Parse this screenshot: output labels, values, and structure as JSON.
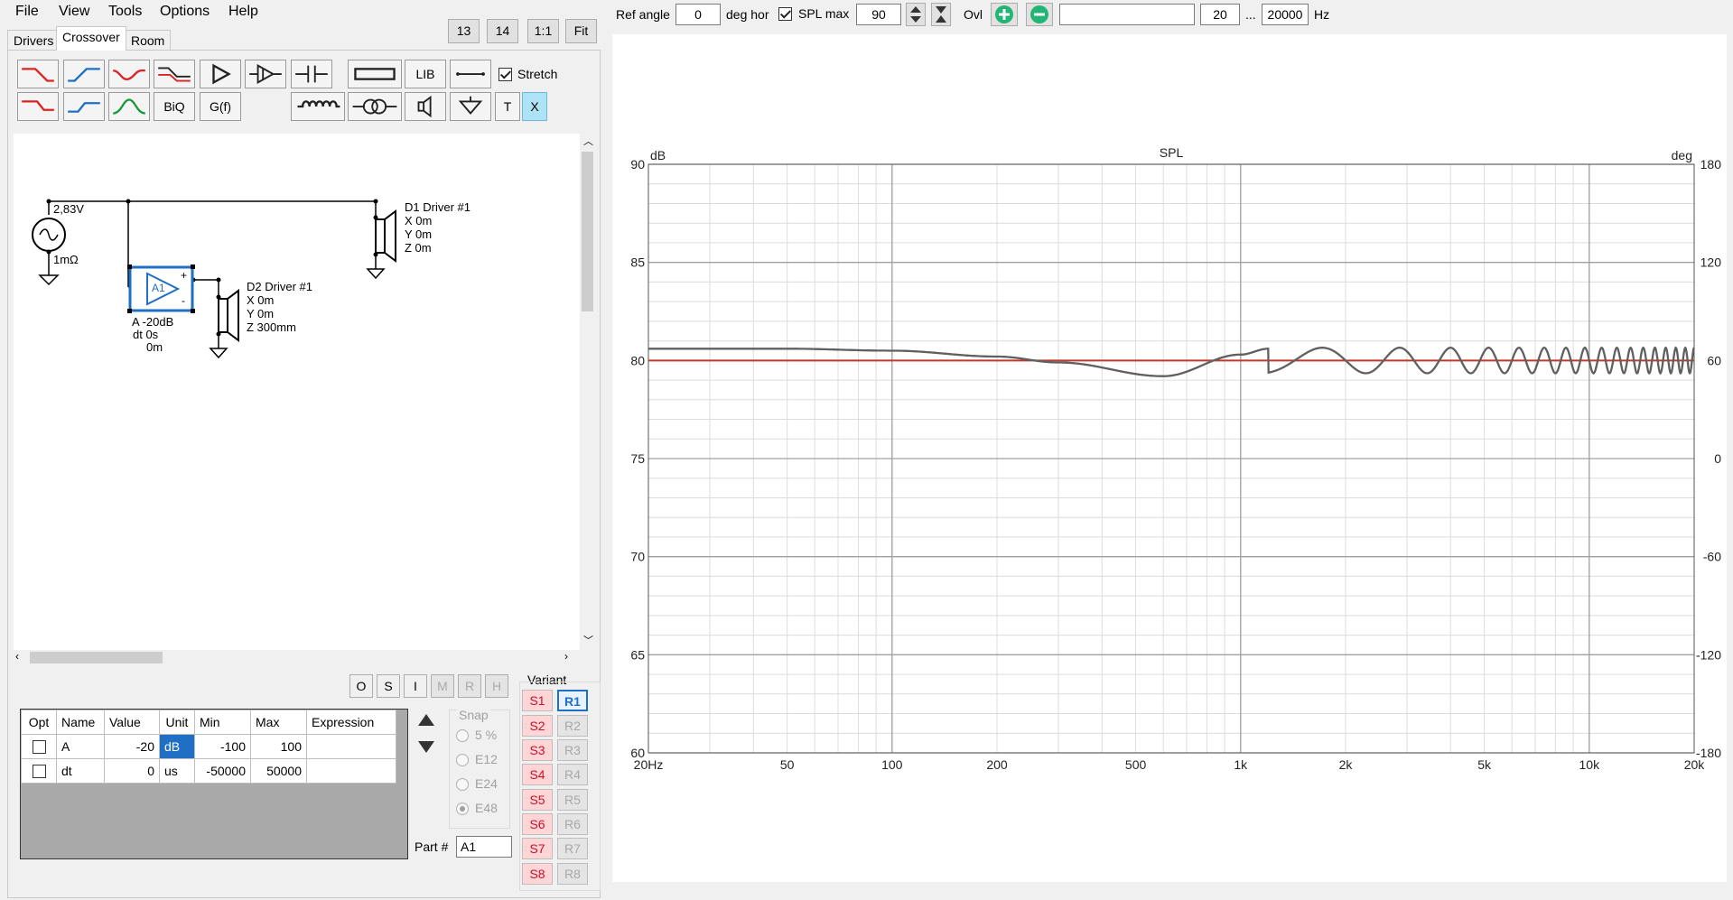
{
  "menu": [
    "File",
    "View",
    "Tools",
    "Options",
    "Help"
  ],
  "tabs": [
    "Drivers",
    "Crossover",
    "Room"
  ],
  "zoom_buttons": [
    "13",
    "14",
    "1:1",
    "Fit"
  ],
  "toolbar": {
    "lib_label": "LIB",
    "biq_label": "BiQ",
    "gf_label": "G(f)",
    "t_label": "T",
    "x_label": "X",
    "stretch_label": "Stretch",
    "stretch_checked": true
  },
  "top_bar": {
    "ref_angle_label": "Ref angle",
    "ref_angle_value": "0",
    "deg_hor_label": "deg hor",
    "spl_max_label": "SPL max",
    "spl_max_checked": true,
    "spl_max_value": "90",
    "ovl_label": "Ovl",
    "ovl_text": "",
    "freq_min": "20",
    "ellipsis": "...",
    "freq_max": "20000",
    "hz_label": "Hz"
  },
  "schematic": {
    "source_voltage": "2,83V",
    "source_impedance": "1mΩ",
    "amp_name": "A1",
    "amp_plus": "+",
    "amp_minus": "-",
    "amp_params": [
      "A -20dB",
      "dt 0s",
      "0m"
    ],
    "d1": {
      "name": "D1 Driver #1",
      "x": "X 0m",
      "y": "Y 0m",
      "z": "Z 0m"
    },
    "d2": {
      "name": "D2 Driver #1",
      "x": "X 0m",
      "y": "Y 0m",
      "z": "Z 300mm"
    }
  },
  "mode_buttons": [
    "O",
    "S",
    "I",
    "M",
    "R",
    "H"
  ],
  "param_table": {
    "headers": [
      "Opt",
      "Name",
      "Value",
      "Unit",
      "Min",
      "Max",
      "Expression"
    ],
    "rows": [
      {
        "name": "A",
        "value": "-20",
        "unit": "dB",
        "min": "-100",
        "max": "100",
        "expression": ""
      },
      {
        "name": "dt",
        "value": "0",
        "unit": "us",
        "min": "-50000",
        "max": "50000",
        "expression": ""
      }
    ]
  },
  "snap": {
    "label": "Snap",
    "options": [
      "5 %",
      "E12",
      "E24",
      "E48"
    ],
    "selected": "E48"
  },
  "part": {
    "label": "Part #",
    "value": "A1"
  },
  "variant": {
    "label": "Variant",
    "s_buttons": [
      "S1",
      "S2",
      "S3",
      "S4",
      "S5",
      "S6",
      "S7",
      "S8"
    ],
    "r_buttons": [
      "R1",
      "R2",
      "R3",
      "R4",
      "R5",
      "R6",
      "R7",
      "R8"
    ],
    "selected": "R1"
  },
  "colors": {
    "accent_blue": "#1f6fc5",
    "spl_curve": "#606060",
    "phase_curve": "#c0392b",
    "grid_major": "#a0a0a0",
    "grid_minor": "#dcdcdc"
  },
  "chart_data": {
    "type": "line",
    "title": "SPL",
    "left_unit": "dB",
    "right_unit": "deg",
    "x_scale": "log",
    "xlim": [
      20,
      20000
    ],
    "x_ticks": [
      "20Hz",
      "50",
      "100",
      "200",
      "500",
      "1k",
      "2k",
      "5k",
      "10k",
      "20k"
    ],
    "x_tick_values": [
      20,
      50,
      100,
      200,
      500,
      1000,
      2000,
      5000,
      10000,
      20000
    ],
    "ylim": [
      60,
      90
    ],
    "y_ticks": [
      "90",
      "85",
      "80",
      "75",
      "70",
      "65",
      "60"
    ],
    "y2lim": [
      -180,
      180
    ],
    "y2_ticks": [
      "180",
      "120",
      "60",
      "0",
      "-60",
      "-120",
      "-180"
    ],
    "grid": true,
    "series": [
      {
        "kind": "spl",
        "description": "summed response, ripple increasing with frequency",
        "x": [
          20,
          50,
          100,
          200,
          300,
          600,
          1000,
          1200,
          2000,
          5000,
          20000
        ],
        "y": [
          80.6,
          80.6,
          80.5,
          80.2,
          79.9,
          79.2,
          80.3,
          80.6,
          79.6,
          80.0,
          80.0
        ]
      },
      {
        "kind": "phase",
        "x": [
          20,
          20000
        ],
        "y": [
          60,
          60
        ]
      }
    ]
  }
}
